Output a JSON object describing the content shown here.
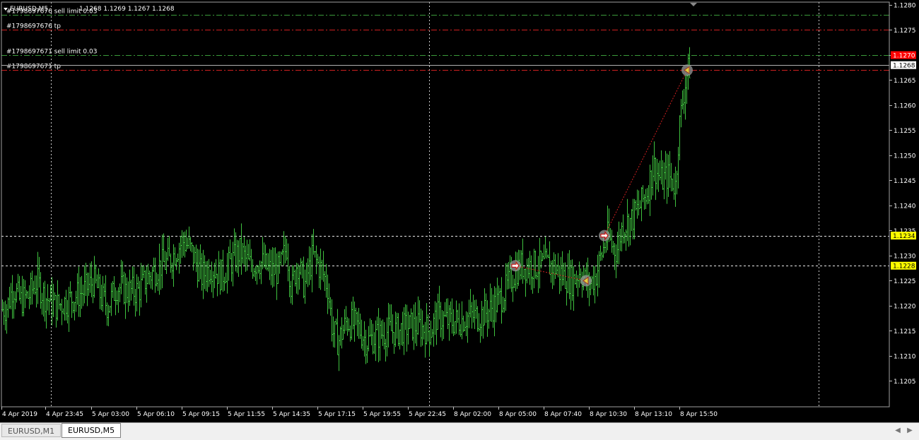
{
  "window": {
    "symbol_header": "EURUSD,M5",
    "ohlc_header": "1.1268 1.1269 1.1267 1.1268"
  },
  "tabs": [
    {
      "label": "EURUSD,M1",
      "active": false
    },
    {
      "label": "EURUSD,M5",
      "active": true
    }
  ],
  "colors": {
    "background": "#000000",
    "bar": "#3fc23f",
    "grid": "#c8c8c8",
    "order_line": "#d02020",
    "sl_line": "#3a9a3a",
    "bid_line": "#b0b0b0",
    "crosshair": "#e8e8e8",
    "highlight_price": "#ffff00",
    "ask_price_box": "#ff0000"
  },
  "chart_data": {
    "type": "ohlc",
    "symbol": "EURUSD",
    "timeframe": "M5",
    "ylim": [
      1.12,
      1.1281
    ],
    "y_ticks": [
      "1.1280",
      "1.1275",
      "1.1270",
      "1.1265",
      "1.1260",
      "1.1255",
      "1.1250",
      "1.1245",
      "1.1240",
      "1.1235",
      "1.1230",
      "1.1225",
      "1.1220",
      "1.1215",
      "1.1210",
      "1.1205"
    ],
    "x_ticks": [
      "4 Apr 2019",
      "4 Apr 23:45",
      "5 Apr 03:00",
      "5 Apr 06:10",
      "5 Apr 09:15",
      "5 Apr 11:55",
      "5 Apr 14:35",
      "5 Apr 17:15",
      "5 Apr 19:55",
      "5 Apr 22:45",
      "8 Apr 02:00",
      "8 Apr 05:00",
      "8 Apr 07:40",
      "8 Apr 10:30",
      "8 Apr 13:10",
      "8 Apr 15:50"
    ],
    "grid": "dashed",
    "price_anchors": [
      [
        0,
        1.1219
      ],
      [
        10,
        1.122
      ],
      [
        18,
        1.1224
      ],
      [
        28,
        1.1221
      ],
      [
        40,
        1.1222
      ],
      [
        52,
        1.1225
      ],
      [
        62,
        1.1222
      ],
      [
        78,
        1.122
      ],
      [
        95,
        1.1221
      ],
      [
        118,
        1.1223
      ],
      [
        132,
        1.1225
      ],
      [
        142,
        1.1222
      ],
      [
        152,
        1.122
      ],
      [
        165,
        1.1224
      ],
      [
        178,
        1.1223
      ],
      [
        195,
        1.1223
      ],
      [
        210,
        1.1226
      ],
      [
        225,
        1.1228
      ],
      [
        240,
        1.1229
      ],
      [
        248,
        1.1231
      ],
      [
        258,
        1.1233
      ],
      [
        266,
        1.1232
      ],
      [
        276,
        1.1229
      ],
      [
        285,
        1.1226
      ],
      [
        298,
        1.1228
      ],
      [
        312,
        1.1226
      ],
      [
        328,
        1.1229
      ],
      [
        340,
        1.1231
      ],
      [
        352,
        1.1228
      ],
      [
        366,
        1.1229
      ],
      [
        382,
        1.1227
      ],
      [
        395,
        1.1227
      ],
      [
        405,
        1.1232
      ],
      [
        412,
        1.1223
      ],
      [
        420,
        1.1229
      ],
      [
        430,
        1.1224
      ],
      [
        442,
        1.123
      ],
      [
        455,
        1.1227
      ],
      [
        463,
        1.1224
      ],
      [
        470,
        1.1215
      ],
      [
        478,
        1.1213
      ],
      [
        490,
        1.1217
      ],
      [
        505,
        1.1216
      ],
      [
        518,
        1.1213
      ],
      [
        532,
        1.1214
      ],
      [
        548,
        1.1215
      ],
      [
        562,
        1.1215
      ],
      [
        578,
        1.1216
      ],
      [
        592,
        1.1216
      ],
      [
        608,
        1.1215
      ],
      [
        618,
        1.1218
      ],
      [
        632,
        1.1217
      ],
      [
        648,
        1.1217
      ],
      [
        662,
        1.1218
      ],
      [
        678,
        1.1218
      ],
      [
        690,
        1.1219
      ],
      [
        705,
        1.1221
      ],
      [
        718,
        1.1224
      ],
      [
        728,
        1.1227
      ],
      [
        738,
        1.1228
      ],
      [
        752,
        1.1228
      ],
      [
        768,
        1.1228
      ],
      [
        782,
        1.1228
      ],
      [
        796,
        1.1226
      ],
      [
        810,
        1.1225
      ],
      [
        820,
        1.1227
      ],
      [
        832,
        1.1224
      ],
      [
        842,
        1.1226
      ],
      [
        850,
        1.123
      ],
      [
        858,
        1.1234
      ],
      [
        866,
        1.1232
      ],
      [
        872,
        1.1231
      ],
      [
        880,
        1.1236
      ],
      [
        892,
        1.1237
      ],
      [
        905,
        1.124
      ],
      [
        915,
        1.1243
      ],
      [
        924,
        1.1248
      ],
      [
        935,
        1.1245
      ],
      [
        945,
        1.1246
      ],
      [
        955,
        1.1244
      ],
      [
        960,
        1.1255
      ],
      [
        966,
        1.1262
      ],
      [
        971,
        1.1266
      ],
      [
        976,
        1.1268
      ]
    ],
    "bid_price": {
      "value": 1.1268,
      "label": "1.1268"
    },
    "ask_price": {
      "value": 1.127,
      "label": "1.1270"
    },
    "level_markers": [
      {
        "value": 1.1234,
        "label": "1.1234"
      },
      {
        "value": 1.1228,
        "label": "1.1228"
      }
    ],
    "order_lines": [
      {
        "value": 1.1278,
        "label": "#1798697676 sell limit 0.03",
        "kind": "sl"
      },
      {
        "value": 1.1275,
        "label": "#1798697676 tp",
        "kind": "tp"
      },
      {
        "value": 1.127,
        "label": "#1798697671 sell limit 0.03",
        "kind": "sl"
      },
      {
        "value": 1.1267,
        "label": "#1798697671 tp",
        "kind": "tp"
      }
    ],
    "trades": [
      {
        "bar_x": 729,
        "price": 1.1228,
        "type": "entry"
      },
      {
        "bar_x": 829,
        "price": 1.1225,
        "type": "exit"
      },
      {
        "bar_x": 855,
        "price": 1.1234,
        "type": "entry"
      },
      {
        "bar_x": 972,
        "price": 1.1267,
        "type": "exit"
      }
    ]
  }
}
